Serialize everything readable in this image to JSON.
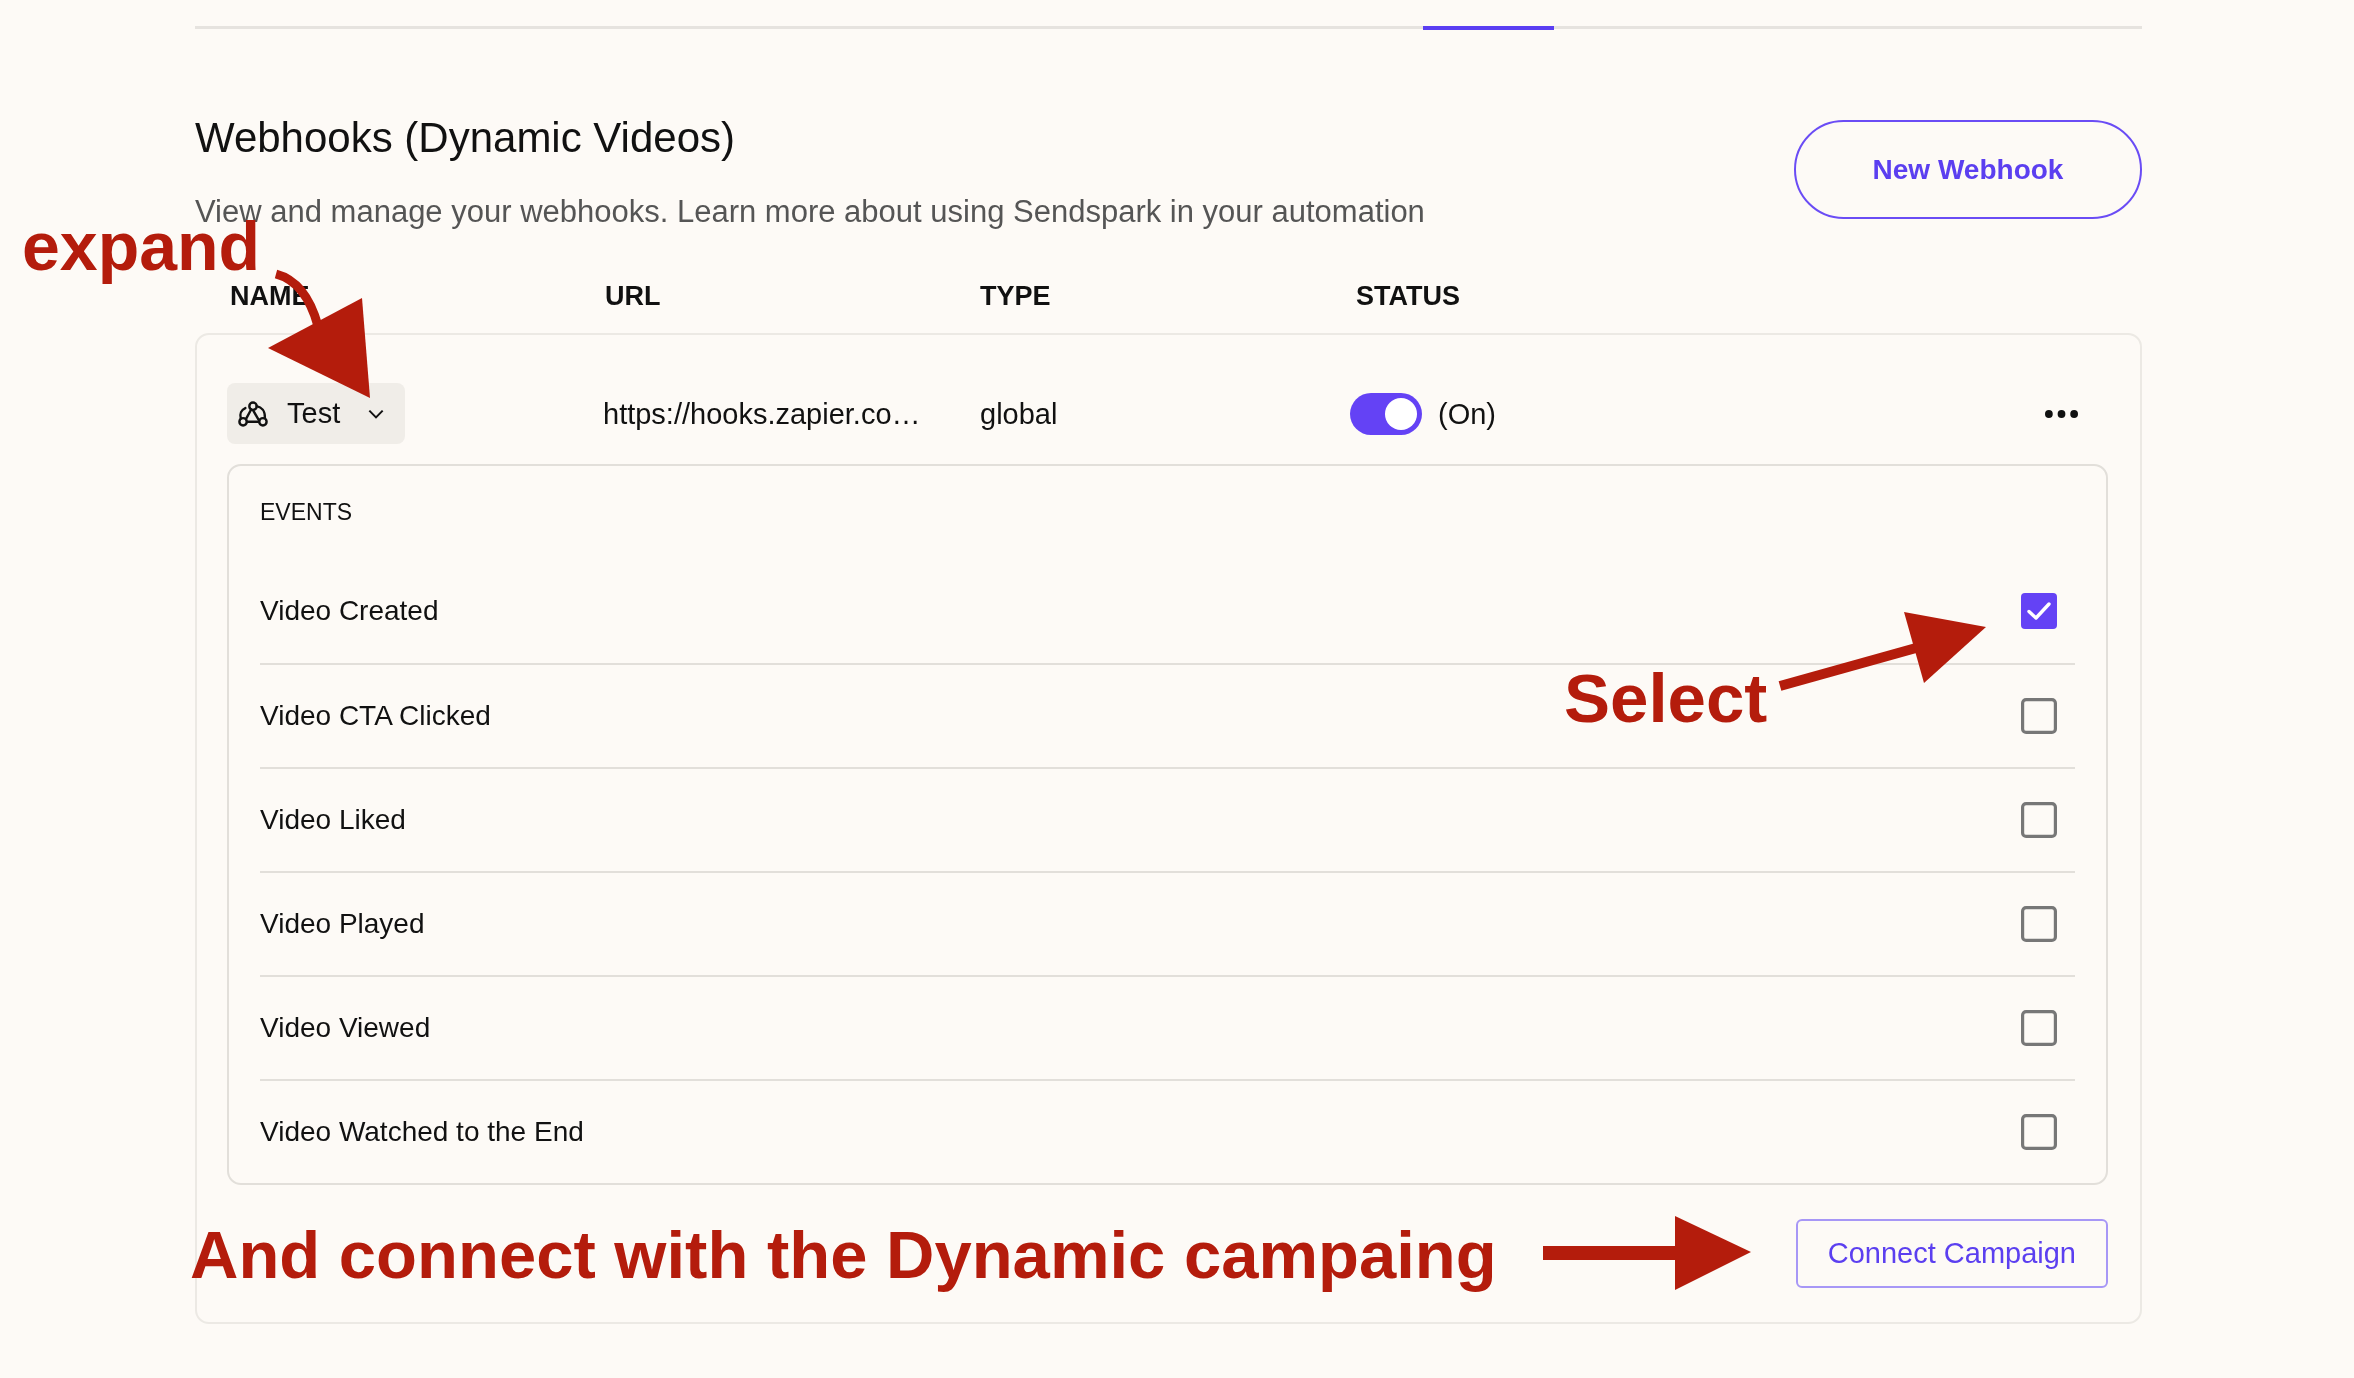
{
  "header": {
    "title": "Webhooks (Dynamic Videos)",
    "description": "View and manage your webhooks. Learn more about using Sendspark in your automation",
    "new_button": "New Webhook"
  },
  "table": {
    "columns": [
      "NAME",
      "URL",
      "TYPE",
      "STATUS"
    ],
    "rows": [
      {
        "name": "Test",
        "expanded": true,
        "url": "https://hooks.zapier.co…",
        "type": "global",
        "status_on": true,
        "status_label": "(On)",
        "events": {
          "heading": "EVENTS",
          "items": [
            {
              "label": "Video Created",
              "checked": true
            },
            {
              "label": "Video CTA Clicked",
              "checked": false
            },
            {
              "label": "Video Liked",
              "checked": false
            },
            {
              "label": "Video Played",
              "checked": false
            },
            {
              "label": "Video Viewed",
              "checked": false
            },
            {
              "label": "Video Watched to the End",
              "checked": false
            }
          ]
        },
        "connect_button": "Connect Campaign"
      }
    ]
  },
  "annotations": [
    {
      "text": "expand"
    },
    {
      "text": "Select"
    },
    {
      "text": "And connect with the Dynamic campaing"
    }
  ]
}
